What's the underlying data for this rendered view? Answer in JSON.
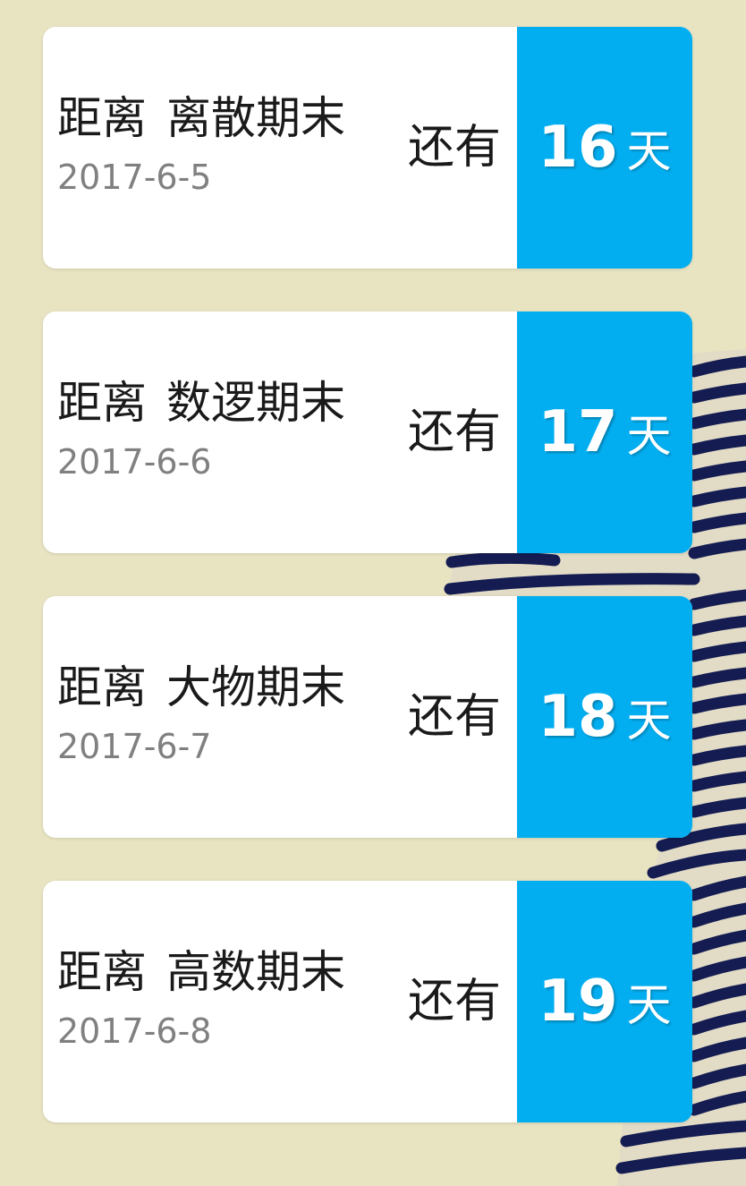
{
  "theme": {
    "background": "#e8e4c2",
    "card_background": "#ffffff",
    "accent": "#03aef0",
    "stripe_color": "#141c52"
  },
  "countdowns": [
    {
      "prefix": "距离",
      "name": "离散期末",
      "date": "2017-6-5",
      "remain_label": "还有",
      "days": "16",
      "unit": "天"
    },
    {
      "prefix": "距离",
      "name": "数逻期末",
      "date": "2017-6-6",
      "remain_label": "还有",
      "days": "17",
      "unit": "天"
    },
    {
      "prefix": "距离",
      "name": "大物期末",
      "date": "2017-6-7",
      "remain_label": "还有",
      "days": "18",
      "unit": "天"
    },
    {
      "prefix": "距离",
      "name": "高数期末",
      "date": "2017-6-8",
      "remain_label": "还有",
      "days": "19",
      "unit": "天"
    }
  ]
}
